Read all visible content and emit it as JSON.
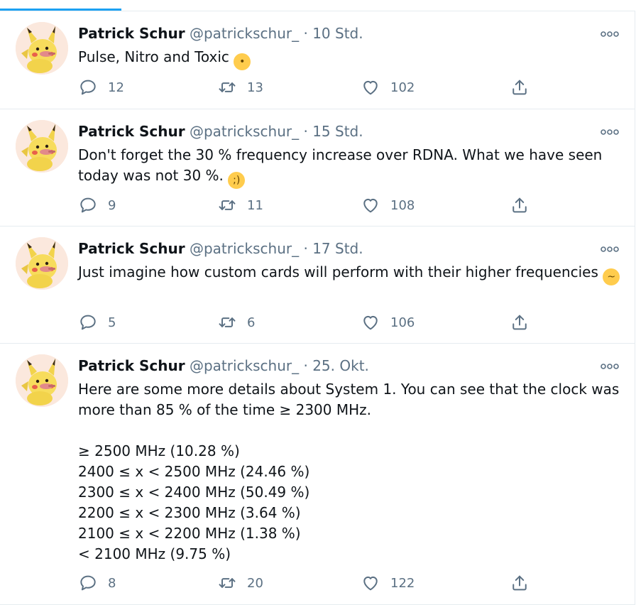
{
  "tweets": [
    {
      "name": "Patrick Schur",
      "handle": "@patrickschur_",
      "separator": "·",
      "time": "10 Std.",
      "text": "Pulse, Nitro and Toxic",
      "emoji": "monocle-face",
      "replies": "12",
      "retweets": "13",
      "likes": "102"
    },
    {
      "name": "Patrick Schur",
      "handle": "@patrickschur_",
      "separator": "·",
      "time": "15 Std.",
      "text": "Don't forget the 30 % frequency increase over RDNA. What we have seen today was not 30 %.",
      "emoji": "winking-face",
      "replies": "9",
      "retweets": "11",
      "likes": "108"
    },
    {
      "name": "Patrick Schur",
      "handle": "@patrickschur_",
      "separator": "·",
      "time": "17 Std.",
      "text": "Just imagine how custom cards will perform with their higher frequencies",
      "emoji": "drooling-face",
      "replies": "5",
      "retweets": "6",
      "likes": "106"
    },
    {
      "name": "Patrick Schur",
      "handle": "@patrickschur_",
      "separator": "·",
      "time": "25. Okt.",
      "text": "Here are some more details about System 1. You can see that the clock was more than 85 % of the time ≥ 2300 MHz.\n\n≥ 2500 MHz (10.28 %)\n2400 ≤ x < 2500 MHz (24.46 %)\n2300 ≤ x < 2400 MHz (50.49 %)\n2200 ≤ x < 2300 MHz (3.64 %)\n2100 ≤ x < 2200 MHz (1.38 %)\n< 2100 MHz (9.75 %)",
      "replies": "8",
      "retweets": "20",
      "likes": "122"
    }
  ],
  "colors": {
    "accent": "#1da1f2",
    "secondary_text": "#5b7083",
    "border": "#e6ecf0"
  },
  "icons": {
    "reply": "reply-icon",
    "retweet": "retweet-icon",
    "like": "heart-icon",
    "share": "share-icon",
    "more": "more-icon"
  }
}
